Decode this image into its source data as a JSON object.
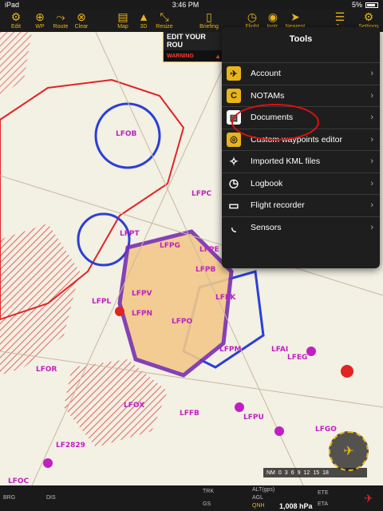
{
  "status": {
    "device": "iPad",
    "time": "3:46 PM",
    "battery": "5%"
  },
  "toolbar": {
    "items": [
      {
        "label": "Edit",
        "icon": "gear-icon"
      },
      {
        "label": "WP",
        "icon": "pin-icon"
      },
      {
        "label": "Route",
        "icon": "route-icon"
      },
      {
        "label": "Clear",
        "icon": "clear-icon"
      },
      {
        "label": "Map",
        "icon": "map-icon"
      },
      {
        "label": "3D",
        "icon": "terrain-icon"
      },
      {
        "label": "Resize",
        "icon": "resize-icon"
      },
      {
        "label": "Briefing",
        "icon": "document-icon"
      },
      {
        "label": "Flight",
        "icon": "stopwatch-icon"
      },
      {
        "label": "Instr.",
        "icon": "gauge-icon"
      },
      {
        "label": "Nearest",
        "icon": "nearest-icon"
      },
      {
        "label": "T...",
        "icon": "menu-icon"
      },
      {
        "label": "Settings",
        "icon": "gear-icon"
      }
    ]
  },
  "route_panel": {
    "title": "EDIT YOUR ROU",
    "warning": "WARNING"
  },
  "tools_menu": {
    "title": "Tools",
    "items": [
      {
        "label": "Account",
        "icon": "plane-icon"
      },
      {
        "label": "NOTAMs",
        "icon": "notam-icon",
        "glyph": "C"
      },
      {
        "label": "Documents",
        "icon": "document-icon"
      },
      {
        "label": "Custom waypoints editor",
        "icon": "waypoint-icon"
      },
      {
        "label": "Imported KML files",
        "icon": "compass-icon"
      },
      {
        "label": "Logbook",
        "icon": "clock-icon"
      },
      {
        "label": "Flight recorder",
        "icon": "recorder-icon"
      },
      {
        "label": "Sensors",
        "icon": "sensor-icon"
      }
    ]
  },
  "map": {
    "labels": [
      "LFOB",
      "LFPC",
      "LFPT",
      "LFPG",
      "LFPB",
      "LFPN",
      "LFPV",
      "LFPO",
      "LFPM",
      "LFPL",
      "LFPK",
      "LFOR",
      "LFOX",
      "LFFB",
      "LFPU",
      "LFOC",
      "LFGO",
      "LF2829",
      "LFPE",
      "LFAI",
      "LFEG"
    ]
  },
  "scale": {
    "unit": "NM",
    "ticks": [
      "0",
      "3",
      "6",
      "9",
      "12",
      "15",
      "18"
    ]
  },
  "bottom_bar": {
    "brg": "BRG",
    "dis": "DIS",
    "trk": "TRK",
    "gs": "GS",
    "alt_gps": "ALT(gps)",
    "agl": "AGL",
    "qnh": "QNH",
    "qnh_value": "1,008 hPa",
    "ete": "ETE",
    "eta": "ETA"
  },
  "colors": {
    "accent": "#e8b418",
    "airspace_red": "#e02424",
    "airspace_blue": "#2b3fd6",
    "airspace_purple": "#7a2fb0",
    "annotation": "#e01010"
  }
}
